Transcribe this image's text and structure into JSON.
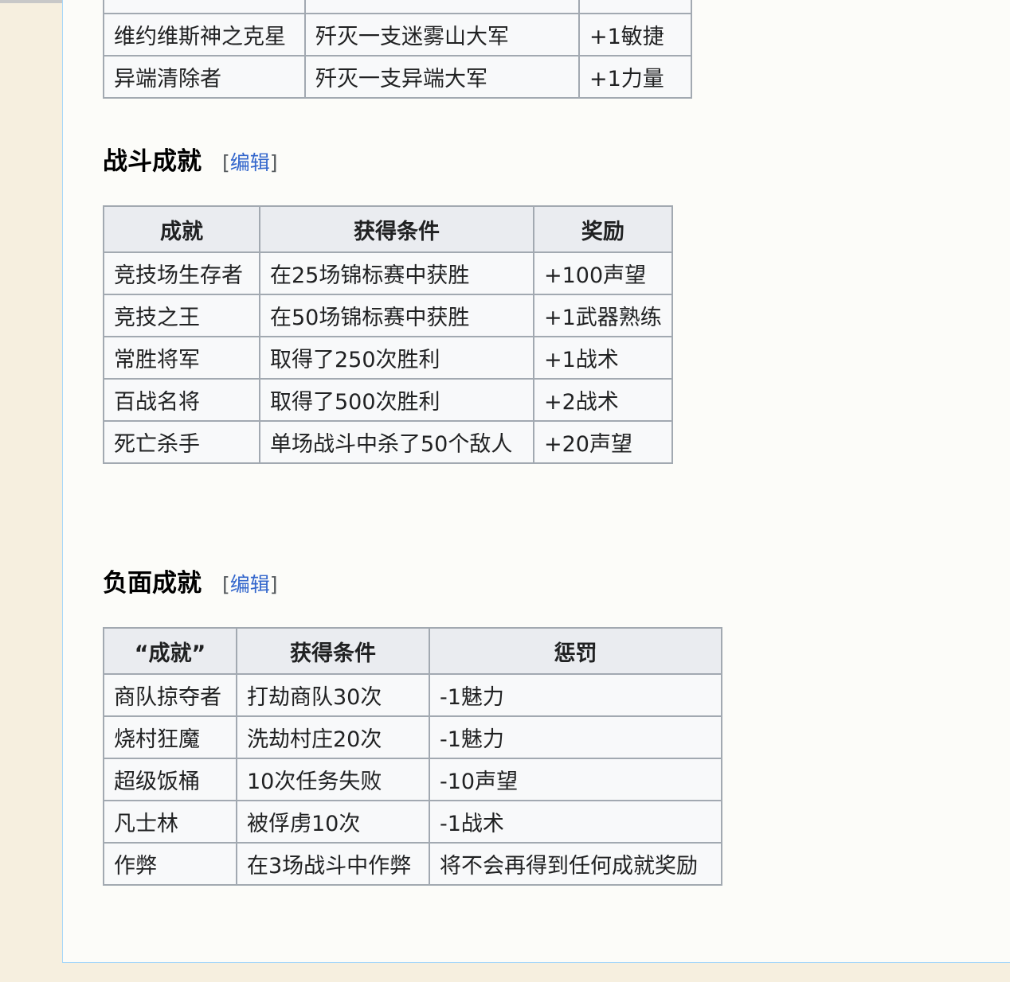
{
  "table1": {
    "rows": [
      [
        "维约维斯神之克星",
        "歼灭一支迷雾山大军",
        "+1敏捷"
      ],
      [
        "异端清除者",
        "歼灭一支异端大军",
        "+1力量"
      ]
    ]
  },
  "section_combat": {
    "title": "战斗成就",
    "edit_open": "[",
    "edit_label": "编辑",
    "edit_close": "]"
  },
  "table_combat": {
    "headers": [
      "成就",
      "获得条件",
      "奖励"
    ],
    "rows": [
      [
        "竞技场生存者",
        "在25场锦标赛中获胜",
        "+100声望"
      ],
      [
        "竞技之王",
        "在50场锦标赛中获胜",
        "+1武器熟练"
      ],
      [
        "常胜将军",
        "取得了250次胜利",
        "+1战术"
      ],
      [
        "百战名将",
        "取得了500次胜利",
        "+2战术"
      ],
      [
        "死亡杀手",
        "单场战斗中杀了50个敌人",
        "+20声望"
      ]
    ]
  },
  "section_negative": {
    "title": "负面成就",
    "edit_open": "[",
    "edit_label": "编辑",
    "edit_close": "]"
  },
  "table_negative": {
    "headers": [
      "“成就”",
      "获得条件",
      "惩罚"
    ],
    "rows": [
      [
        "商队掠夺者",
        "打劫商队30次",
        "-1魅力"
      ],
      [
        "烧村狂魔",
        "洗劫村庄20次",
        "-1魅力"
      ],
      [
        "超级饭桶",
        "10次任务失败",
        "-10声望"
      ],
      [
        "凡士林",
        "被俘虏10次",
        "-1战术"
      ],
      [
        "作弊",
        "在3场战斗中作弊",
        "将不会再得到任何成就奖励"
      ]
    ]
  }
}
